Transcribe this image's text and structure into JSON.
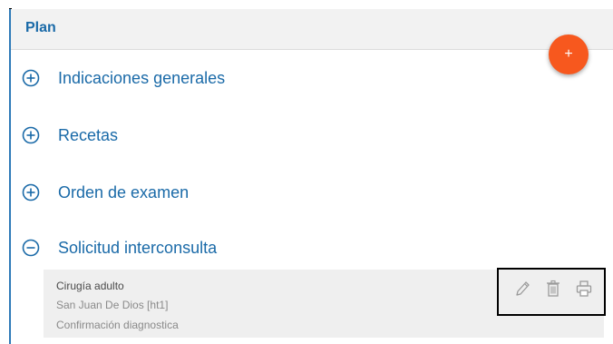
{
  "header": {
    "title": "Plan"
  },
  "fab": {
    "label": "+"
  },
  "sections": [
    {
      "label": "Indicaciones generales",
      "icon": "plus-circle-icon"
    },
    {
      "label": "Recetas",
      "icon": "plus-circle-icon"
    },
    {
      "label": "Orden de examen",
      "icon": "plus-circle-icon"
    },
    {
      "label": "Solicitud interconsulta",
      "icon": "minus-circle-icon"
    }
  ],
  "interconsulta_item": {
    "title": "Cirugía adulto",
    "location": "San Juan De Dios [ht1]",
    "reason": "Confirmación diagnostica"
  },
  "actions": [
    "pencil-icon",
    "trash-icon",
    "print-icon"
  ],
  "colors": {
    "accent": "#1a6aa8",
    "fab": "#f7581e",
    "header_bg": "#f2f2f2",
    "item_bg": "#efefef"
  }
}
